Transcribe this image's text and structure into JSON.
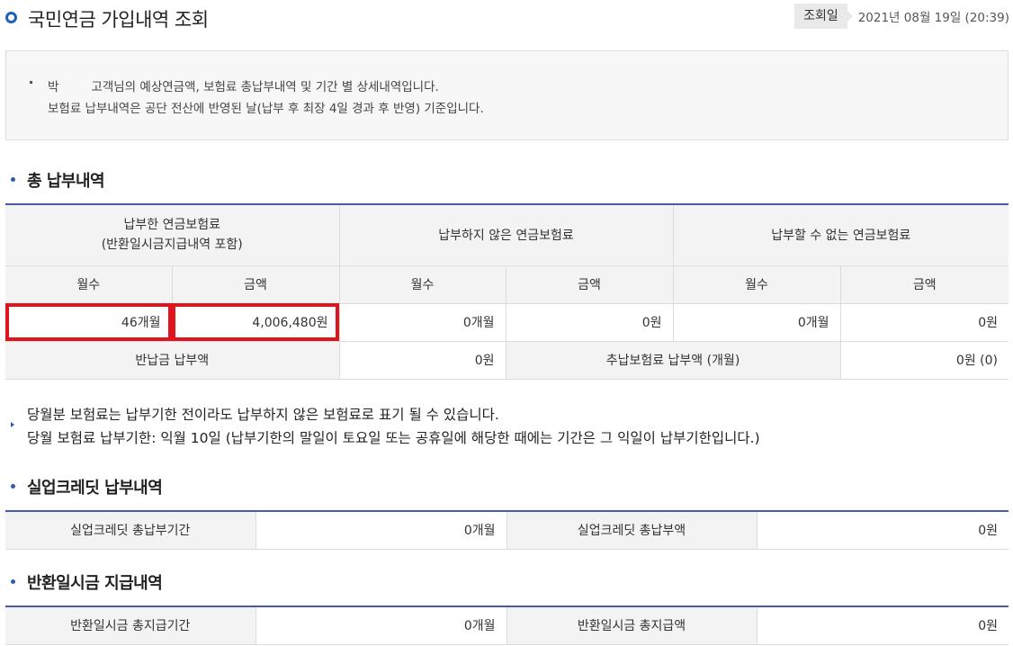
{
  "header": {
    "title": "국민연금 가입내역 조회",
    "date_label": "조회일",
    "date_value": "2021년 08월 19일 (20:39)"
  },
  "notice": {
    "customer_prefix": "박",
    "line1_suffix": "고객님의 예상연금액, 보험료 총납부내역 및 기간 별 상세내역입니다.",
    "line2": "보험료 납부내역은 공단 전산에 반영된 날(납부 후 최장 4일 경과 후 반영) 기준입니다."
  },
  "total_payment": {
    "section_title": "총 납부내역",
    "group_paid_line1": "납부한 연금보험료",
    "group_paid_line2": "(반환일시금지급내역 포함)",
    "group_unpaid": "납부하지 않은 연금보험료",
    "group_unpayable": "납부할 수 없는 연금보험료",
    "col_months": "월수",
    "col_amount": "금액",
    "paid_months": "46개월",
    "paid_amount": "4,006,480원",
    "unpaid_months": "0개월",
    "unpaid_amount": "0원",
    "unpayable_months": "0개월",
    "unpayable_amount": "0원",
    "refund_label": "반납금 납부액",
    "refund_value": "0원",
    "additional_label": "추납보험료 납부액 (개월)",
    "additional_value": "0원 (0)"
  },
  "info": {
    "line1": "당월분 보험료는 납부기한 전이라도 납부하지 않은 보험료로 표기 될 수 있습니다.",
    "line2": "당월 보험료 납부기한: 익월 10일 (납부기한의 말일이 토요일 또는 공휴일에 해당한 때에는 기간은 그 익일이 납부기한입니다.)"
  },
  "unemployment_credit": {
    "section_title": "실업크레딧 납부내역",
    "period_label": "실업크레딧 총납부기간",
    "period_value": "0개월",
    "amount_label": "실업크레딧 총납부액",
    "amount_value": "0원"
  },
  "lump_sum_refund": {
    "section_title": "반환일시금 지급내역",
    "period_label": "반환일시금 총지급기간",
    "period_value": "0개월",
    "amount_label": "반환일시금 총지급액",
    "amount_value": "0원"
  },
  "colors": {
    "accent": "#4a5aa8",
    "highlight": "#e0141c",
    "header_bg": "#f3f3f3"
  },
  "icons": {
    "title": "circle-icon",
    "section": "bullet-dot-icon",
    "info": "arrow-right-icon"
  }
}
